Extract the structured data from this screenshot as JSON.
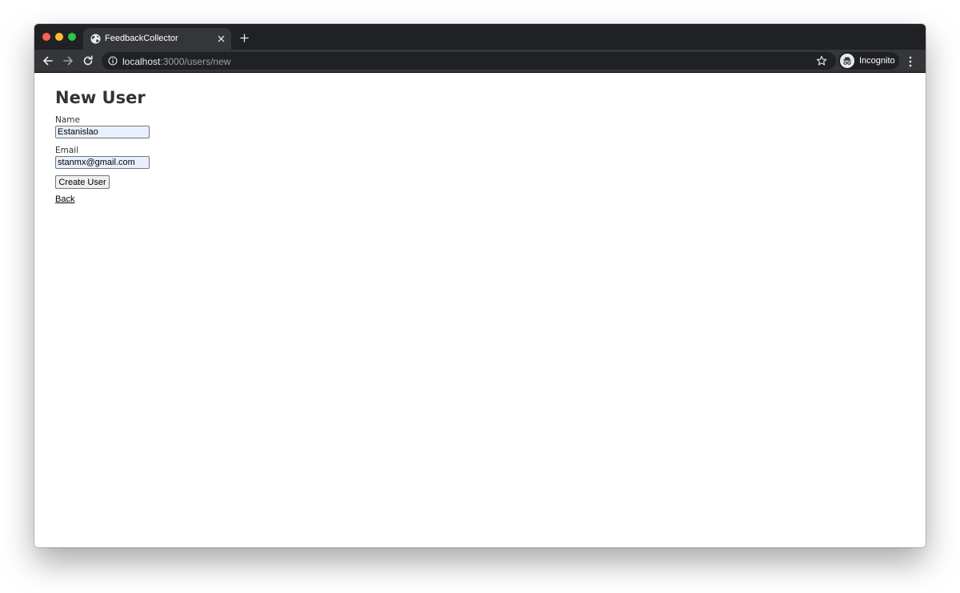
{
  "browser": {
    "tab": {
      "title": "FeedbackCollector"
    },
    "url": {
      "host": "localhost",
      "path": ":3000/users/new"
    },
    "profile_label": "Incognito"
  },
  "page": {
    "title": "New User",
    "form": {
      "name_label": "Name",
      "name_value": "Estanislao",
      "email_label": "Email",
      "email_value": "stanmx@gmail.com",
      "submit_label": "Create User"
    },
    "back_link": "Back"
  },
  "colors": {
    "tab_strip": "#202124",
    "toolbar": "#35363a",
    "autofill_input": "#e8f0fe",
    "heading_text": "#333333"
  }
}
